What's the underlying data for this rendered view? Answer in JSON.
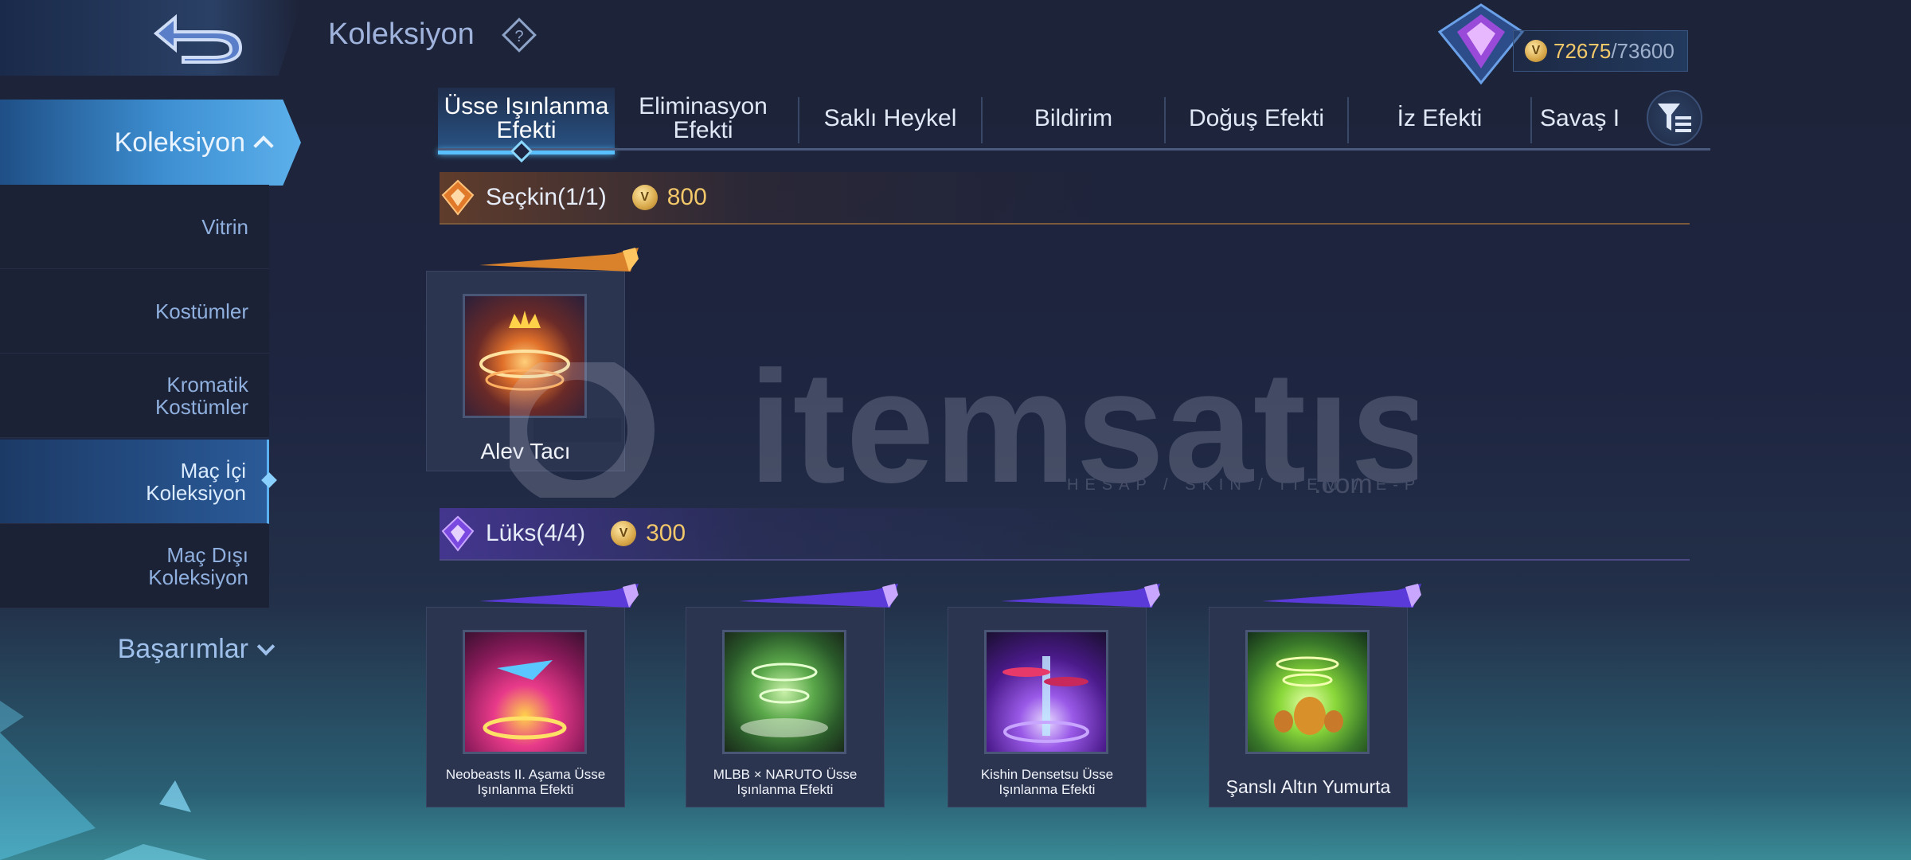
{
  "header": {
    "title": "Koleksiyon",
    "currency_current": "72675",
    "currency_sep_max": "/73600"
  },
  "sidebar": {
    "active": "Koleksiyon",
    "items": [
      {
        "label": "Vitrin"
      },
      {
        "label": "Kostümler"
      },
      {
        "label": "Kromatik\nKostümler"
      },
      {
        "label": "Maç İçi\nKoleksiyon"
      },
      {
        "label": "Maç Dışı\nKoleksiyon"
      }
    ],
    "achievements": "Başarımlar"
  },
  "tabs": [
    {
      "label": "Üsse Işınlanma Efekti"
    },
    {
      "label": "Eliminasyon Efekti"
    },
    {
      "label": "Saklı Heykel"
    },
    {
      "label": "Bildirim"
    },
    {
      "label": "Doğuş Efekti"
    },
    {
      "label": "İz Efekti"
    },
    {
      "label": "Savaş I"
    }
  ],
  "sections": {
    "elite": {
      "title": "Seçkin(1/1)",
      "price": "800",
      "color": "#e07a2a"
    },
    "luxury": {
      "title": "Lüks(4/4)",
      "price": "300",
      "color": "#8a5ae0"
    }
  },
  "items": {
    "elite": [
      {
        "name": "Alev Tacı",
        "icon": "flame-crown-icon"
      }
    ],
    "luxury": [
      {
        "name": "Neobeasts II. Aşama Üsse Işınlanma Efekti",
        "icon": "neobeasts-icon"
      },
      {
        "name": "MLBB × NARUTO Üsse Işınlanma Efekti",
        "icon": "naruto-whirlwind-icon"
      },
      {
        "name": "Kishin Densetsu Üsse Işınlanma Efekti",
        "icon": "kishin-portal-icon"
      },
      {
        "name": "Şanslı Altın Yumurta",
        "icon": "golden-egg-icon"
      }
    ]
  },
  "watermark": {
    "text": "itemsatıs",
    "tagline": "HESAP / SKIN / ITEM / E-PIN",
    "suffix": ".com"
  }
}
